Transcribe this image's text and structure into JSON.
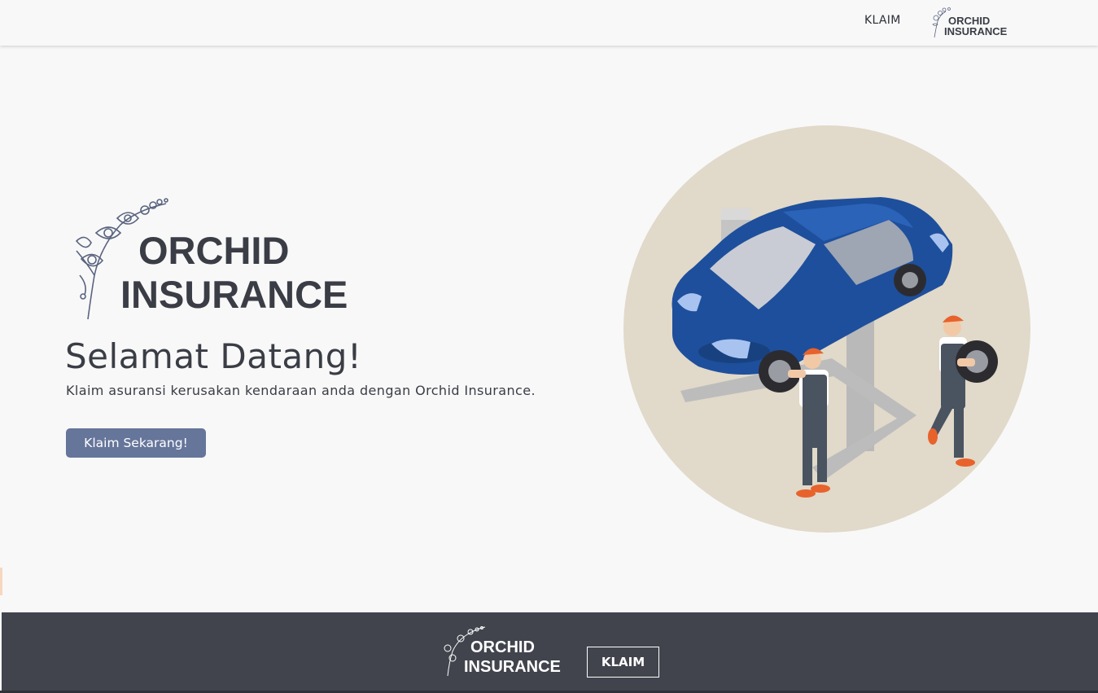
{
  "navbar": {
    "link_label": "KLAIM",
    "logo_line1": "ORCHID",
    "logo_line2": "INSURANCE"
  },
  "hero": {
    "logo_line1": "ORCHID",
    "logo_line2": "INSURANCE",
    "title": "Selamat Datang!",
    "subtitle": "Klaim asuransi kerusakan kendaraan anda dengan Orchid Insurance.",
    "cta_label": "Klaim Sekarang!",
    "illustration_icon": "car-repair-illustration"
  },
  "footer": {
    "logo_line1": "ORCHID",
    "logo_line2": "INSURANCE",
    "button_label": "KLAIM"
  },
  "colors": {
    "background": "#f8f8f8",
    "text_dark": "#3a3d45",
    "button_primary": "#66759a",
    "footer_bg": "#41444d",
    "circle_bg": "#e1d9c9",
    "car_blue": "#1e4f9c",
    "worker_orange": "#e8622c"
  }
}
